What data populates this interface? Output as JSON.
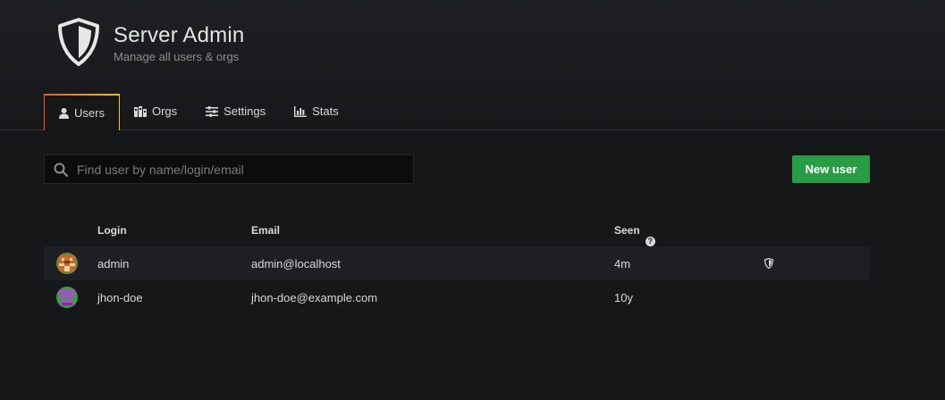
{
  "header": {
    "title": "Server Admin",
    "subtitle": "Manage all users & orgs",
    "icon": "shield-icon"
  },
  "tabs": [
    {
      "label": "Users",
      "icon": "user-icon",
      "active": true
    },
    {
      "label": "Orgs",
      "icon": "building-icon",
      "active": false
    },
    {
      "label": "Settings",
      "icon": "sliders-icon",
      "active": false
    },
    {
      "label": "Stats",
      "icon": "bar-chart-icon",
      "active": false
    }
  ],
  "search": {
    "placeholder": "Find user by name/login/email",
    "value": ""
  },
  "actions": {
    "new_user_label": "New user"
  },
  "table": {
    "columns": {
      "login": "Login",
      "email": "Email",
      "seen": "Seen"
    },
    "rows": [
      {
        "login": "admin",
        "email": "admin@localhost",
        "seen": "4m",
        "is_admin": true,
        "avatar_color": "#b45a1c"
      },
      {
        "login": "jhon-doe",
        "email": "jhon-doe@example.com",
        "seen": "10y",
        "is_admin": false,
        "avatar_color": "#25a52a"
      }
    ]
  },
  "colors": {
    "background": "#161719",
    "accent_gradient_start": "#f05a28",
    "accent_gradient_end": "#fbca0a",
    "primary_button": "#299c46"
  }
}
